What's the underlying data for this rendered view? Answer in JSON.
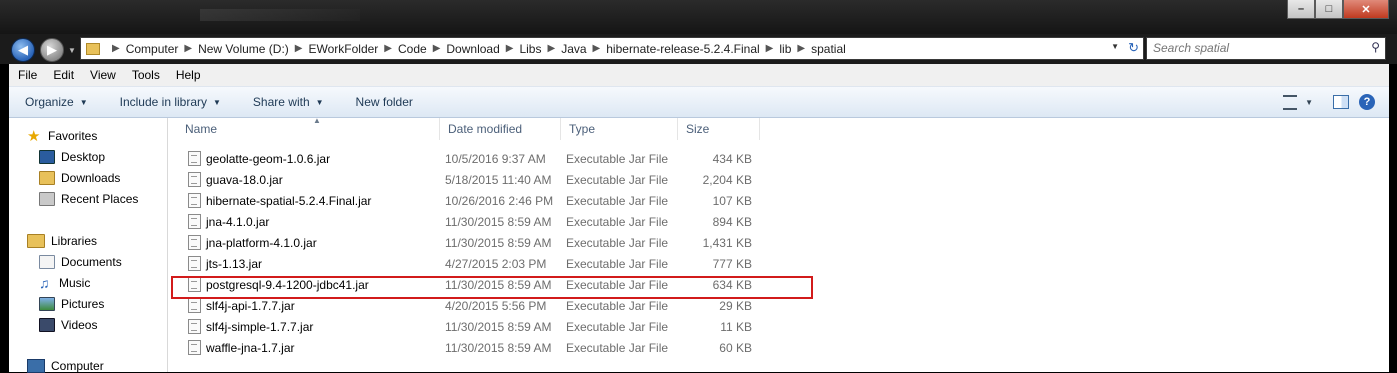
{
  "window": {
    "minimize": "–",
    "maximize": "□",
    "close": "✕"
  },
  "nav": {
    "back_icon": "back-arrow-icon",
    "forward_icon": "forward-arrow-icon"
  },
  "address": {
    "crumbs": [
      "Computer",
      "New Volume (D:)",
      "EWorkFolder",
      "Code",
      "Download",
      "Libs",
      "Java",
      "hibernate-release-5.2.4.Final",
      "lib",
      "spatial"
    ]
  },
  "search": {
    "placeholder": "Search spatial"
  },
  "menu": [
    "File",
    "Edit",
    "View",
    "Tools",
    "Help"
  ],
  "toolbar": {
    "organize": "Organize",
    "include": "Include in library",
    "share": "Share with",
    "new_folder": "New folder"
  },
  "sidebar": {
    "favorites": "Favorites",
    "desktop": "Desktop",
    "downloads": "Downloads",
    "recent": "Recent Places",
    "libraries": "Libraries",
    "documents": "Documents",
    "music": "Music",
    "pictures": "Pictures",
    "videos": "Videos",
    "computer": "Computer"
  },
  "columns": {
    "name": "Name",
    "date": "Date modified",
    "type": "Type",
    "size": "Size"
  },
  "files": [
    {
      "name": "geolatte-geom-1.0.6.jar",
      "date": "10/5/2016 9:37 AM",
      "type": "Executable Jar File",
      "size": "434 KB"
    },
    {
      "name": "guava-18.0.jar",
      "date": "5/18/2015 11:40 AM",
      "type": "Executable Jar File",
      "size": "2,204 KB"
    },
    {
      "name": "hibernate-spatial-5.2.4.Final.jar",
      "date": "10/26/2016 2:46 PM",
      "type": "Executable Jar File",
      "size": "107 KB"
    },
    {
      "name": "jna-4.1.0.jar",
      "date": "11/30/2015 8:59 AM",
      "type": "Executable Jar File",
      "size": "894 KB"
    },
    {
      "name": "jna-platform-4.1.0.jar",
      "date": "11/30/2015 8:59 AM",
      "type": "Executable Jar File",
      "size": "1,431 KB"
    },
    {
      "name": "jts-1.13.jar",
      "date": "4/27/2015 2:03 PM",
      "type": "Executable Jar File",
      "size": "777 KB"
    },
    {
      "name": "postgresql-9.4-1200-jdbc41.jar",
      "date": "11/30/2015 8:59 AM",
      "type": "Executable Jar File",
      "size": "634 KB"
    },
    {
      "name": "slf4j-api-1.7.7.jar",
      "date": "4/20/2015 5:56 PM",
      "type": "Executable Jar File",
      "size": "29 KB"
    },
    {
      "name": "slf4j-simple-1.7.7.jar",
      "date": "11/30/2015 8:59 AM",
      "type": "Executable Jar File",
      "size": "11 KB"
    },
    {
      "name": "waffle-jna-1.7.jar",
      "date": "11/30/2015 8:59 AM",
      "type": "Executable Jar File",
      "size": "60 KB"
    }
  ],
  "colors": {
    "highlight": "#d21b1b",
    "accent": "#2a64b8"
  }
}
